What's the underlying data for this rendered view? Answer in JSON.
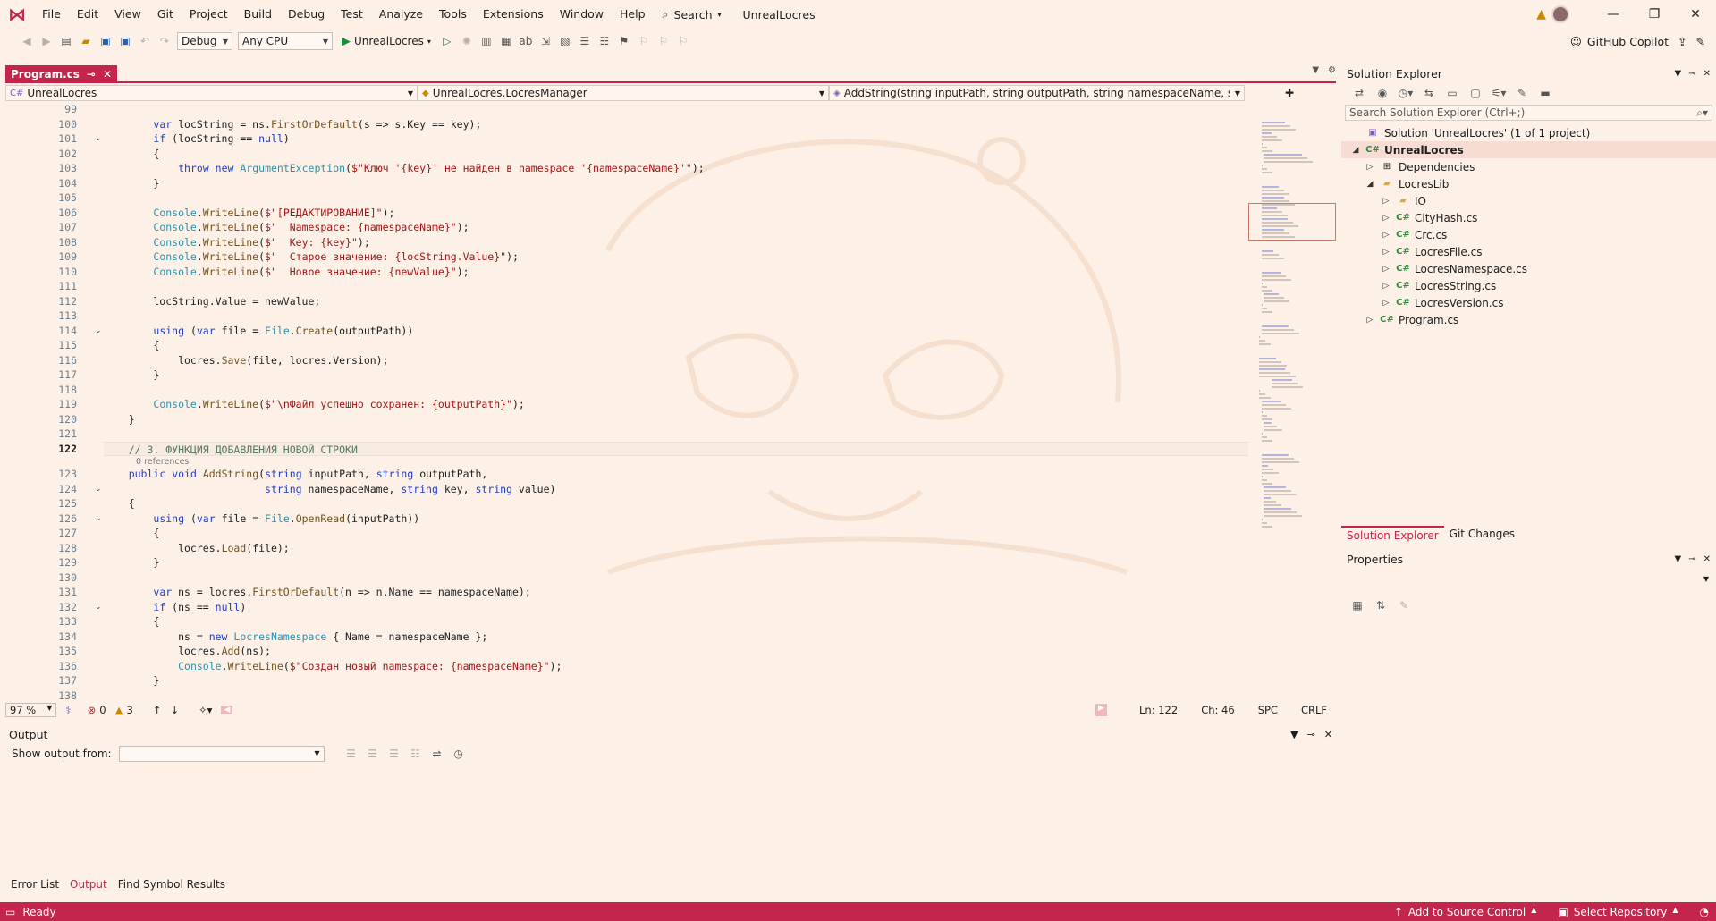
{
  "menu": [
    "File",
    "Edit",
    "View",
    "Git",
    "Project",
    "Build",
    "Debug",
    "Test",
    "Analyze",
    "Tools",
    "Extensions",
    "Window",
    "Help"
  ],
  "search_label": "Search",
  "app_title": "UnrealLocres",
  "toolbar": {
    "config": "Debug",
    "platform": "Any CPU",
    "run_target": "UnrealLocres",
    "copilot": "GitHub Copilot"
  },
  "doc_tab": {
    "label": "Program.cs"
  },
  "navbar": {
    "project": "UnrealLocres",
    "type": "UnrealLocres.LocresManager",
    "member": "AddString(string inputPath, string outputPath, string namespaceName, string ke"
  },
  "editor": {
    "reference_hint": "0 references",
    "lines": [
      {
        "n": "99",
        "t": ""
      },
      {
        "n": "100",
        "t": "        var locString = ns.FirstOrDefault(s => s.Key == key);"
      },
      {
        "n": "101",
        "t": "        if (locString == null)"
      },
      {
        "n": "102",
        "t": "        {"
      },
      {
        "n": "103",
        "t": "            throw new ArgumentException($\"Ключ '{key}' не найден в namespace '{namespaceName}'\");"
      },
      {
        "n": "104",
        "t": "        }"
      },
      {
        "n": "105",
        "t": ""
      },
      {
        "n": "106",
        "t": "        Console.WriteLine($\"[РЕДАКТИРОВАНИЕ]\");"
      },
      {
        "n": "107",
        "t": "        Console.WriteLine($\"  Namespace: {namespaceName}\");"
      },
      {
        "n": "108",
        "t": "        Console.WriteLine($\"  Key: {key}\");"
      },
      {
        "n": "109",
        "t": "        Console.WriteLine($\"  Старое значение: {locString.Value}\");"
      },
      {
        "n": "110",
        "t": "        Console.WriteLine($\"  Новое значение: {newValue}\");"
      },
      {
        "n": "111",
        "t": ""
      },
      {
        "n": "112",
        "t": "        locString.Value = newValue;"
      },
      {
        "n": "113",
        "t": ""
      },
      {
        "n": "114",
        "t": "        using (var file = File.Create(outputPath))"
      },
      {
        "n": "115",
        "t": "        {"
      },
      {
        "n": "116",
        "t": "            locres.Save(file, locres.Version);"
      },
      {
        "n": "117",
        "t": "        }"
      },
      {
        "n": "118",
        "t": ""
      },
      {
        "n": "119",
        "t": "        Console.WriteLine($\"\\nФайл успешно сохранен: {outputPath}\");"
      },
      {
        "n": "120",
        "t": "    }"
      },
      {
        "n": "121",
        "t": ""
      },
      {
        "n": "122",
        "t": "    // 3. ФУНКЦИЯ ДОБАВЛЕНИЯ НОВОЙ СТРОКИ"
      },
      {
        "n": "123",
        "t": "    public void AddString(string inputPath, string outputPath,"
      },
      {
        "n": "124",
        "t": "                          string namespaceName, string key, string value)"
      },
      {
        "n": "125",
        "t": "    {"
      },
      {
        "n": "126",
        "t": "        using (var file = File.OpenRead(inputPath))"
      },
      {
        "n": "127",
        "t": "        {"
      },
      {
        "n": "128",
        "t": "            locres.Load(file);"
      },
      {
        "n": "129",
        "t": "        }"
      },
      {
        "n": "130",
        "t": ""
      },
      {
        "n": "131",
        "t": "        var ns = locres.FirstOrDefault(n => n.Name == namespaceName);"
      },
      {
        "n": "132",
        "t": "        if (ns == null)"
      },
      {
        "n": "133",
        "t": "        {"
      },
      {
        "n": "134",
        "t": "            ns = new LocresNamespace { Name = namespaceName };"
      },
      {
        "n": "135",
        "t": "            locres.Add(ns);"
      },
      {
        "n": "136",
        "t": "            Console.WriteLine($\"Создан новый namespace: {namespaceName}\");"
      },
      {
        "n": "137",
        "t": "        }"
      },
      {
        "n": "138",
        "t": ""
      }
    ],
    "current_line": "122",
    "folded_lines": [
      "101",
      "114",
      "124",
      "126",
      "132"
    ]
  },
  "editor_status": {
    "zoom": "97 %",
    "errors": "0",
    "warnings": "3",
    "ln": "Ln: 122",
    "ch": "Ch: 46",
    "spc": "SPC",
    "eol": "CRLF"
  },
  "output": {
    "title": "Output",
    "show_from": "Show output from:"
  },
  "bottom_tabs": [
    "Error List",
    "Output",
    "Find Symbol Results"
  ],
  "solution_explorer": {
    "title": "Solution Explorer",
    "search_placeholder": "Search Solution Explorer (Ctrl+;)",
    "solution": "Solution 'UnrealLocres' (1 of 1 project)",
    "project": "UnrealLocres",
    "dependencies": "Dependencies",
    "folder": "LocresLib",
    "subfolder": "IO",
    "files": [
      "CityHash.cs",
      "Crc.cs",
      "LocresFile.cs",
      "LocresNamespace.cs",
      "LocresString.cs",
      "LocresVersion.cs"
    ],
    "program": "Program.cs",
    "tabs": [
      "Solution Explorer",
      "Git Changes"
    ]
  },
  "properties": {
    "title": "Properties"
  },
  "statusbar": {
    "ready": "Ready",
    "add_source": "Add to Source Control",
    "select_repo": "Select Repository"
  },
  "colors": {
    "accent": "#c4254a",
    "background": "#fdf0e6"
  }
}
